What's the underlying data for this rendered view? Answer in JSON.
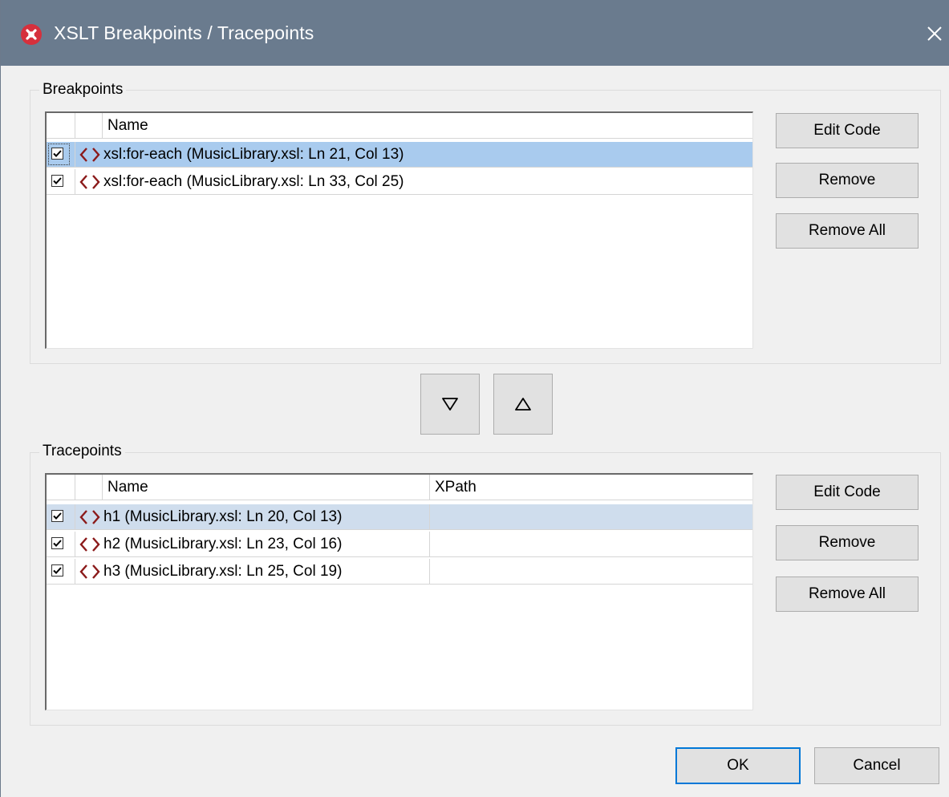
{
  "window": {
    "title": "XSLT Breakpoints / Tracepoints",
    "app_icon": "altova-x-icon",
    "close_icon": "close-icon"
  },
  "breakpoints": {
    "label": "Breakpoints",
    "columns": [
      "",
      "",
      "Name"
    ],
    "rows": [
      {
        "checked": true,
        "icon": "xml-tag-icon",
        "name": "xsl:for-each  (MusicLibrary.xsl: Ln 21, Col 13)",
        "selected": true
      },
      {
        "checked": true,
        "icon": "xml-tag-icon",
        "name": "xsl:for-each  (MusicLibrary.xsl: Ln 33, Col 25)",
        "selected": false
      }
    ],
    "buttons": {
      "edit_code": "Edit Code",
      "remove": "Remove",
      "remove_all": "Remove All"
    }
  },
  "move": {
    "down_icon": "triangle-down-icon",
    "up_icon": "triangle-up-icon"
  },
  "tracepoints": {
    "label": "Tracepoints",
    "columns": [
      "",
      "",
      "Name",
      "XPath"
    ],
    "rows": [
      {
        "checked": true,
        "icon": "xml-tag-icon",
        "name": "h1  (MusicLibrary.xsl: Ln 20, Col 13)",
        "xpath": "",
        "selected": true
      },
      {
        "checked": true,
        "icon": "xml-tag-icon",
        "name": "h2  (MusicLibrary.xsl: Ln 23, Col 16)",
        "xpath": "",
        "selected": false
      },
      {
        "checked": true,
        "icon": "xml-tag-icon",
        "name": "h3  (MusicLibrary.xsl: Ln 25, Col 19)",
        "xpath": "",
        "selected": false
      }
    ],
    "buttons": {
      "edit_code": "Edit Code",
      "remove": "Remove",
      "remove_all": "Remove All"
    }
  },
  "footer": {
    "ok": "OK",
    "cancel": "Cancel"
  },
  "colors": {
    "titlebar": "#6a7b8e",
    "selection_active": "#a9cbee",
    "selection_inactive": "#cfdded",
    "tag_icon": "#8b1a1a",
    "default_button_border": "#0078d7"
  }
}
